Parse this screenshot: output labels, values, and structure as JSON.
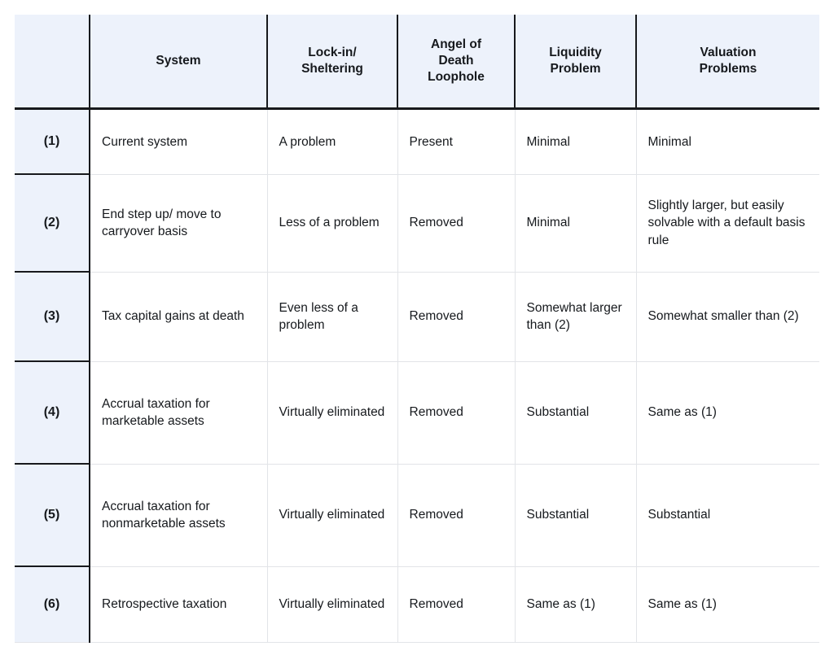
{
  "table": {
    "columns": [
      {
        "key": "num",
        "label": ""
      },
      {
        "key": "sys",
        "label": "System"
      },
      {
        "key": "lock",
        "label": "Lock-in/\nSheltering"
      },
      {
        "key": "angel",
        "label": "Angel of\nDeath\nLoophole"
      },
      {
        "key": "liq",
        "label": "Liquidity\nProblem"
      },
      {
        "key": "val",
        "label": "Valuation\nProblems"
      }
    ],
    "headers": {
      "blank": "",
      "system": "System",
      "lockin_line1": "Lock-in/",
      "lockin_line2": "Sheltering",
      "angel_line1": "Angel of",
      "angel_line2": "Death",
      "angel_line3": "Loophole",
      "liquidity_line1": "Liquidity",
      "liquidity_line2": "Problem",
      "valuation_line1": "Valuation",
      "valuation_line2": "Problems"
    },
    "rows": [
      {
        "num": "(1)",
        "system": "Current system",
        "lockin": "A problem",
        "angel": "Present",
        "liquidity": "Minimal",
        "valuation": "Minimal"
      },
      {
        "num": "(2)",
        "system": "End step up/ move to carryover basis",
        "lockin": "Less of a problem",
        "angel": "Removed",
        "liquidity": "Minimal",
        "valuation": "Slightly larger, but easily solvable with a default basis rule"
      },
      {
        "num": "(3)",
        "system": "Tax capital gains at death",
        "lockin": "Even less of a problem",
        "angel": "Removed",
        "liquidity": "Somewhat larger than (2)",
        "valuation": "Somewhat smaller than (2)"
      },
      {
        "num": "(4)",
        "system": "Accrual taxation for marketable assets",
        "lockin": "Virtually eliminated",
        "angel": "Removed",
        "liquidity": "Substantial",
        "valuation": "Same as (1)"
      },
      {
        "num": "(5)",
        "system": "Accrual taxation for nonmarketable assets",
        "lockin": "Virtually eliminated",
        "angel": "Removed",
        "liquidity": "Substantial",
        "valuation": "Substantial"
      },
      {
        "num": "(6)",
        "system": "Retrospective taxation",
        "lockin": "Virtually eliminated",
        "angel": "Removed",
        "liquidity": "Same as (1)",
        "valuation": "Same as (1)"
      }
    ]
  },
  "colors": {
    "header_background": "#edf2fb",
    "rownum_background": "#edf2fb",
    "rule_strong": "#17191c",
    "rule_light": "#e2e4e8",
    "text": "#16191d",
    "page_background": "#ffffff"
  }
}
